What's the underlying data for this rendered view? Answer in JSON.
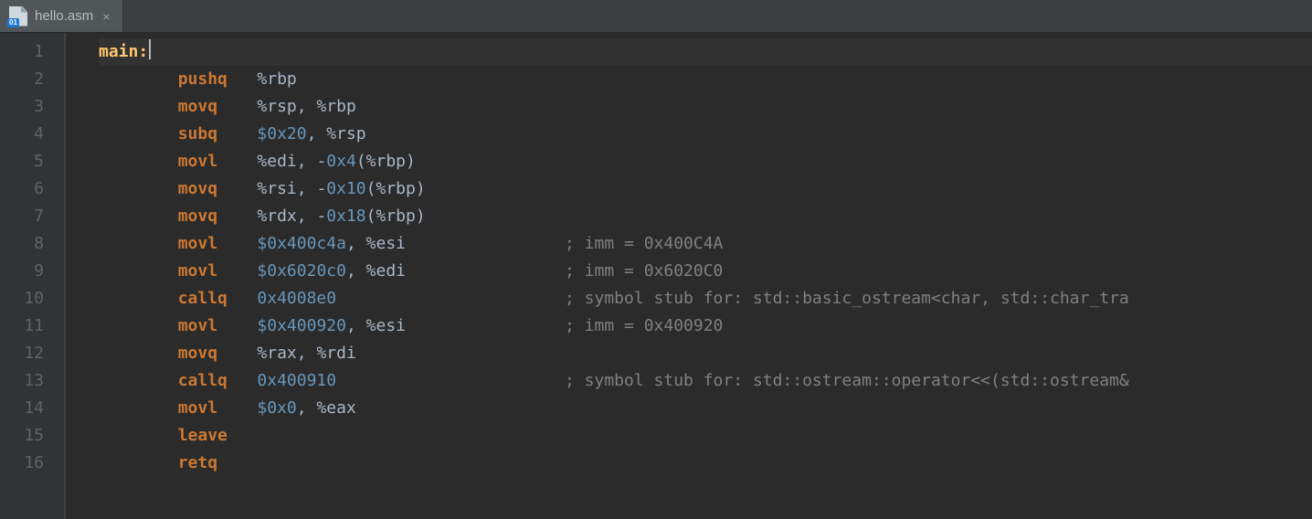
{
  "tab": {
    "filename": "hello.asm",
    "badge_label": "01",
    "close_glyph": "×"
  },
  "code": {
    "lines": [
      {
        "n": 1,
        "indent": "",
        "label": "main:",
        "instr": "",
        "args": [],
        "comment": "",
        "active": true,
        "cursor": true
      },
      {
        "n": 2,
        "indent": "        ",
        "instr": "pushq",
        "pad": "   ",
        "args": [
          {
            "t": "reg",
            "v": "%rbp"
          }
        ],
        "comment": ""
      },
      {
        "n": 3,
        "indent": "        ",
        "instr": "movq",
        "pad": "    ",
        "args": [
          {
            "t": "reg",
            "v": "%rsp"
          },
          {
            "t": "punct",
            "v": ", "
          },
          {
            "t": "reg",
            "v": "%rbp"
          }
        ],
        "comment": ""
      },
      {
        "n": 4,
        "indent": "        ",
        "instr": "subq",
        "pad": "    ",
        "args": [
          {
            "t": "num",
            "v": "$0x20"
          },
          {
            "t": "punct",
            "v": ", "
          },
          {
            "t": "reg",
            "v": "%rsp"
          }
        ],
        "comment": ""
      },
      {
        "n": 5,
        "indent": "        ",
        "instr": "movl",
        "pad": "    ",
        "args": [
          {
            "t": "reg",
            "v": "%edi"
          },
          {
            "t": "punct",
            "v": ", -"
          },
          {
            "t": "num",
            "v": "0x4"
          },
          {
            "t": "punct",
            "v": "("
          },
          {
            "t": "reg",
            "v": "%rbp"
          },
          {
            "t": "punct",
            "v": ")"
          }
        ],
        "comment": ""
      },
      {
        "n": 6,
        "indent": "        ",
        "instr": "movq",
        "pad": "    ",
        "args": [
          {
            "t": "reg",
            "v": "%rsi"
          },
          {
            "t": "punct",
            "v": ", -"
          },
          {
            "t": "num",
            "v": "0x10"
          },
          {
            "t": "punct",
            "v": "("
          },
          {
            "t": "reg",
            "v": "%rbp"
          },
          {
            "t": "punct",
            "v": ")"
          }
        ],
        "comment": ""
      },
      {
        "n": 7,
        "indent": "        ",
        "instr": "movq",
        "pad": "    ",
        "args": [
          {
            "t": "reg",
            "v": "%rdx"
          },
          {
            "t": "punct",
            "v": ", -"
          },
          {
            "t": "num",
            "v": "0x18"
          },
          {
            "t": "punct",
            "v": "("
          },
          {
            "t": "reg",
            "v": "%rbp"
          },
          {
            "t": "punct",
            "v": ")"
          }
        ],
        "comment": ""
      },
      {
        "n": 8,
        "indent": "        ",
        "instr": "movl",
        "pad": "    ",
        "args": [
          {
            "t": "num",
            "v": "$0x400c4a"
          },
          {
            "t": "punct",
            "v": ", "
          },
          {
            "t": "reg",
            "v": "%esi"
          }
        ],
        "comment": "; imm = 0x400C4A"
      },
      {
        "n": 9,
        "indent": "        ",
        "instr": "movl",
        "pad": "    ",
        "args": [
          {
            "t": "num",
            "v": "$0x6020c0"
          },
          {
            "t": "punct",
            "v": ", "
          },
          {
            "t": "reg",
            "v": "%edi"
          }
        ],
        "comment": "; imm = 0x6020C0"
      },
      {
        "n": 10,
        "indent": "        ",
        "instr": "callq",
        "pad": "   ",
        "args": [
          {
            "t": "num",
            "v": "0x4008e0"
          }
        ],
        "comment": "; symbol stub for: std::basic_ostream<char, std::char_tra"
      },
      {
        "n": 11,
        "indent": "        ",
        "instr": "movl",
        "pad": "    ",
        "args": [
          {
            "t": "num",
            "v": "$0x400920"
          },
          {
            "t": "punct",
            "v": ", "
          },
          {
            "t": "reg",
            "v": "%esi"
          }
        ],
        "comment": "; imm = 0x400920"
      },
      {
        "n": 12,
        "indent": "        ",
        "instr": "movq",
        "pad": "    ",
        "args": [
          {
            "t": "reg",
            "v": "%rax"
          },
          {
            "t": "punct",
            "v": ", "
          },
          {
            "t": "reg",
            "v": "%rdi"
          }
        ],
        "comment": ""
      },
      {
        "n": 13,
        "indent": "        ",
        "instr": "callq",
        "pad": "   ",
        "args": [
          {
            "t": "num",
            "v": "0x400910"
          }
        ],
        "comment": "; symbol stub for: std::ostream::operator<<(std::ostream&"
      },
      {
        "n": 14,
        "indent": "        ",
        "instr": "movl",
        "pad": "    ",
        "args": [
          {
            "t": "num",
            "v": "$0x0"
          },
          {
            "t": "punct",
            "v": ", "
          },
          {
            "t": "reg",
            "v": "%eax"
          }
        ],
        "comment": ""
      },
      {
        "n": 15,
        "indent": "        ",
        "instr": "leave",
        "pad": "",
        "args": [],
        "comment": ""
      },
      {
        "n": 16,
        "indent": "        ",
        "instr": "retq",
        "pad": "",
        "args": [],
        "comment": ""
      }
    ]
  }
}
